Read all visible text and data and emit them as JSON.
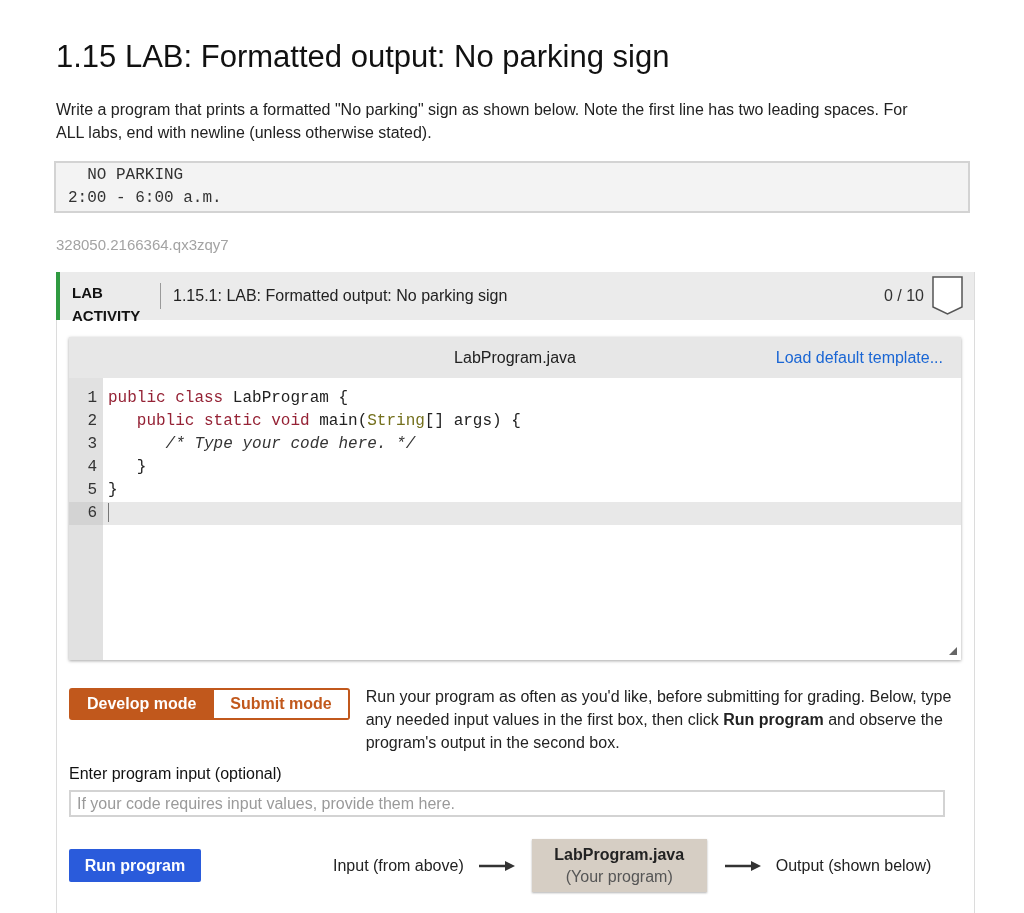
{
  "page": {
    "title": "1.15 LAB: Formatted output: No parking sign",
    "instructions": "Write a program that prints a formatted \"No parking\" sign as shown below. Note the first line has two leading spaces. For ALL labs, end with newline (unless otherwise stated).",
    "sample_output": [
      "  NO PARKING",
      "2:00 - 6:00 a.m."
    ],
    "activity_id": "328050.2166364.qx3zqy7"
  },
  "lab_activity": {
    "label": "LAB ACTIVITY",
    "title": "1.15.1: LAB: Formatted output: No parking sign",
    "score": "0 / 10"
  },
  "editor": {
    "filename": "LabProgram.java",
    "load_template_link": "Load default template...",
    "lines": [
      {
        "number": "1",
        "active": false,
        "tokens": [
          {
            "kind": "keyword",
            "text": "public class"
          },
          {
            "kind": "text",
            "text": " LabProgram {"
          }
        ]
      },
      {
        "number": "2",
        "active": false,
        "tokens": [
          {
            "kind": "keyword",
            "text": "   public static void"
          },
          {
            "kind": "text",
            "text": " main("
          },
          {
            "kind": "type",
            "text": "String"
          },
          {
            "kind": "text",
            "text": "[] args) {"
          }
        ]
      },
      {
        "number": "3",
        "active": false,
        "tokens": [
          {
            "kind": "comment",
            "text": "      /* Type your code here. */"
          }
        ]
      },
      {
        "number": "4",
        "active": false,
        "tokens": [
          {
            "kind": "text",
            "text": "   }"
          }
        ]
      },
      {
        "number": "5",
        "active": false,
        "tokens": [
          {
            "kind": "text",
            "text": "}"
          }
        ]
      },
      {
        "number": "6",
        "active": true
      }
    ]
  },
  "modes": [
    {
      "label": "Develop mode",
      "selected": true
    },
    {
      "label": "Submit mode",
      "selected": false
    }
  ],
  "mode_description": "Run your program as often as you'd like, before submitting for grading. Below, type any needed input values in the first box, then click **Run program** and observe the program's output in the second box.",
  "program_input": {
    "label": "Enter program input (optional)",
    "placeholder": "If your code requires input values, provide them here."
  },
  "run_button": "Run program",
  "flow": {
    "input_label": "Input (from above)",
    "program_name": "LabProgram.java",
    "program_caption": "(Your program)",
    "output_label": "Output (shown below)"
  }
}
